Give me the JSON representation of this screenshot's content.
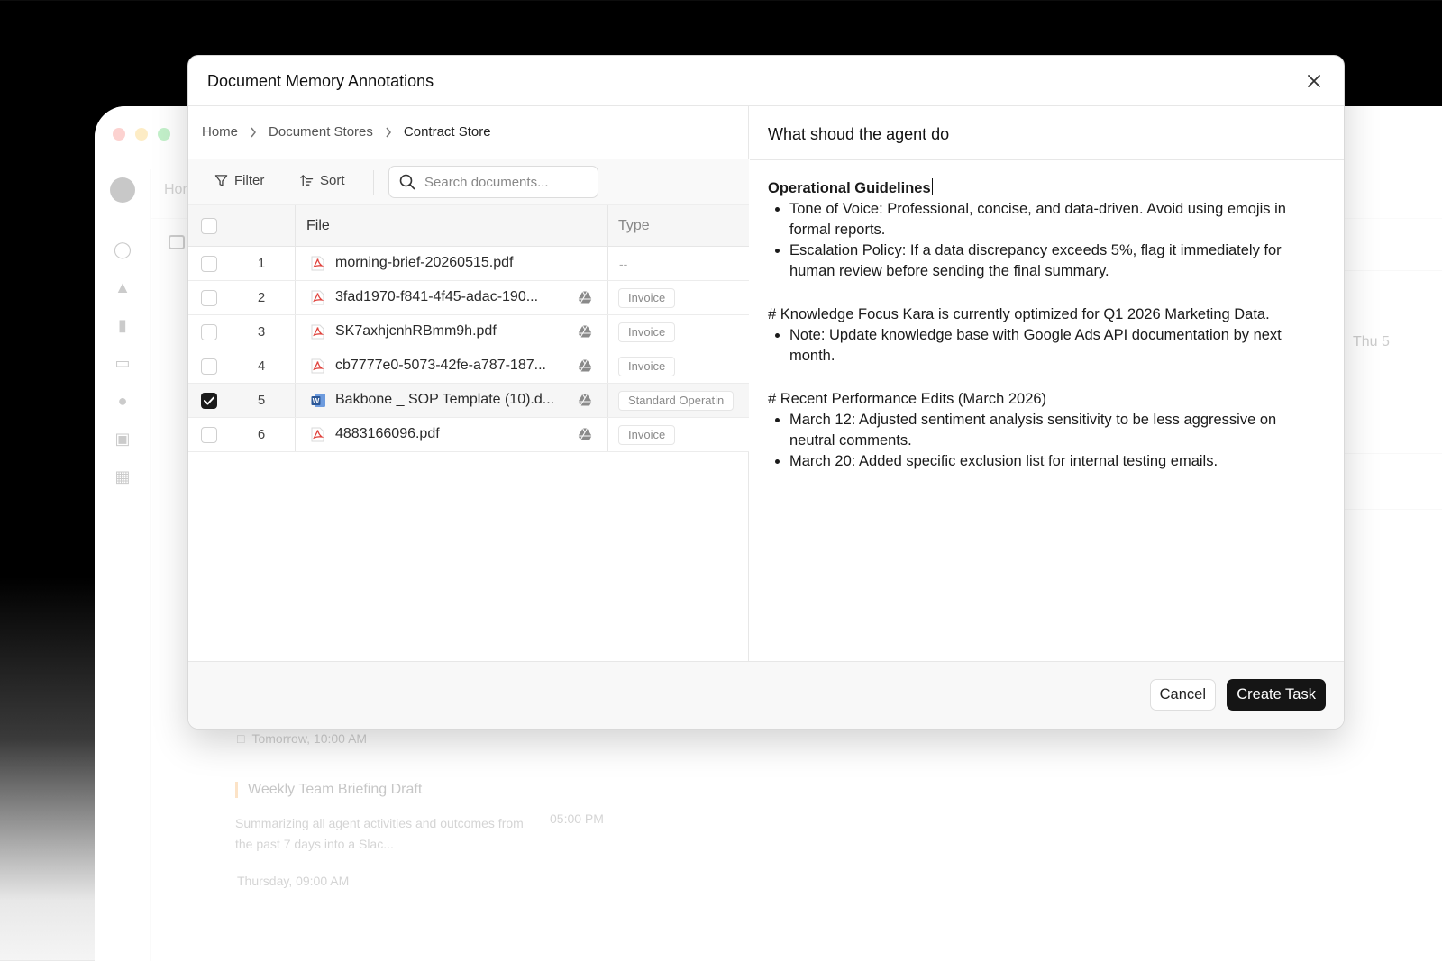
{
  "background_app": {
    "home_crumb": "Hom",
    "day_label": "Thu 5",
    "task_due": "Tomorrow, 10:00 AM",
    "task_title": "Weekly Team Briefing Draft",
    "task_description": "Summarizing all agent activities and outcomes from the past 7 days into a Slac...",
    "task_time": "05:00 PM",
    "task_due_2": "Thursday, 09:00 AM"
  },
  "modal": {
    "title": "Document Memory Annotations",
    "breadcrumb": [
      "Home",
      "Document Stores",
      "Contract Store"
    ],
    "toolbar": {
      "filter_label": "Filter",
      "sort_label": "Sort",
      "search_placeholder": "Search documents..."
    },
    "table": {
      "columns": [
        "File",
        "Type"
      ],
      "rows": [
        {
          "num": "1",
          "file": "morning-brief-20260515.pdf",
          "icon": "pdf-icon",
          "type": "--",
          "checked": false,
          "cloud": false
        },
        {
          "num": "2",
          "file": "3fad1970-f841-4f45-adac-190...",
          "icon": "pdf-icon",
          "type": "Invoice",
          "checked": false,
          "cloud": true
        },
        {
          "num": "3",
          "file": "SK7axhjcnhRBmm9h.pdf",
          "icon": "pdf-icon",
          "type": "Invoice",
          "checked": false,
          "cloud": true
        },
        {
          "num": "4",
          "file": "cb7777e0-5073-42fe-a787-187...",
          "icon": "pdf-icon",
          "type": "Invoice",
          "checked": false,
          "cloud": true
        },
        {
          "num": "5",
          "file": "Bakbone _ SOP Template (10).d...",
          "icon": "word-icon",
          "type": "Standard Operatin",
          "checked": true,
          "cloud": true
        },
        {
          "num": "6",
          "file": "4883166096.pdf",
          "icon": "pdf-icon",
          "type": "Invoice",
          "checked": false,
          "cloud": true
        }
      ]
    },
    "instructions": {
      "title": "What shoud the agent do",
      "heading": "Operational Guidelines",
      "bullets_1": [
        "Tone of Voice: Professional, concise, and data-driven. Avoid using emojis in formal reports.",
        "Escalation Policy: If a data discrepancy exceeds 5%, flag it immediately for human review before sending the final summary."
      ],
      "line_2": "# Knowledge Focus Kara is currently optimized for Q1 2026 Marketing Data.",
      "bullets_2": [
        "Note: Update knowledge base with Google Ads API documentation by next month."
      ],
      "line_3": "# Recent Performance Edits (March 2026)",
      "bullets_3": [
        "March 12: Adjusted sentiment analysis sensitivity to be less aggressive on neutral comments.",
        "March 20: Added specific exclusion list for internal testing emails."
      ]
    },
    "footer": {
      "cancel_label": "Cancel",
      "create_label": "Create Task"
    }
  },
  "colors": {
    "primary_button": "#151515",
    "pdf_red": "#e0443e",
    "word_blue": "#2b5797"
  }
}
